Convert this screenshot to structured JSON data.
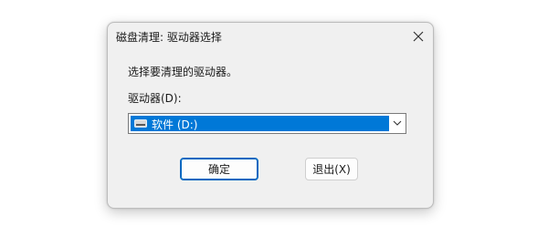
{
  "dialog": {
    "title": "磁盘清理: 驱动器选择",
    "prompt": "选择要清理的驱动器。",
    "drive_label": "驱动器(D):",
    "selected_drive": "软件 (D:)",
    "buttons": {
      "ok_label": "确定",
      "exit_label": "退出(X)"
    }
  },
  "icons": {
    "close": "close-icon",
    "drive": "drive-icon",
    "dropdown": "chevron-down-icon"
  },
  "colors": {
    "selection": "#0078d7",
    "primary_button_border": "#0067c0",
    "dialog_bg": "#f0f0f0"
  }
}
